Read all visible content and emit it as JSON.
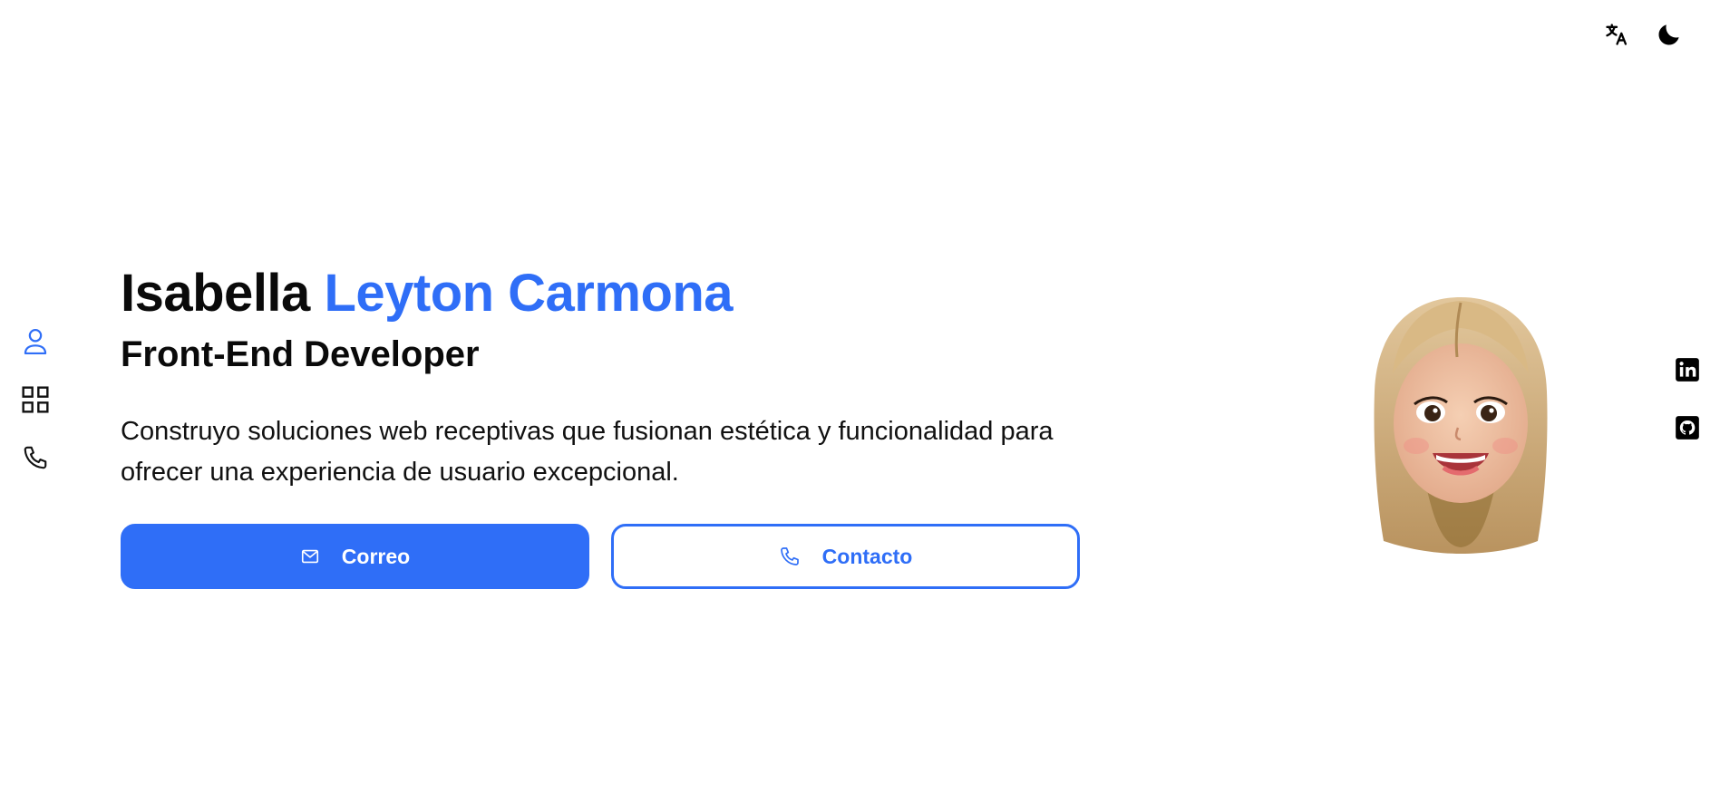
{
  "header": {
    "translate_icon": "translate-icon",
    "theme_icon": "moon-icon"
  },
  "nav": {
    "items": [
      {
        "icon": "user-icon",
        "active": true
      },
      {
        "icon": "grid-icon",
        "active": false
      },
      {
        "icon": "phone-icon",
        "active": false
      }
    ]
  },
  "social": {
    "items": [
      {
        "icon": "linkedin-icon"
      },
      {
        "icon": "github-icon"
      }
    ]
  },
  "hero": {
    "first_name": "Isabella",
    "last_name": "Leyton Carmona",
    "role": "Front-End Developer",
    "description": "Construyo soluciones web receptivas que fusionan estética y funcionalidad para ofrecer una experiencia de usuario excepcional.",
    "email_button": "Correo",
    "contact_button": "Contacto"
  },
  "colors": {
    "accent": "#2f6ef7",
    "text": "#0a0a0a",
    "background": "#ffffff"
  }
}
